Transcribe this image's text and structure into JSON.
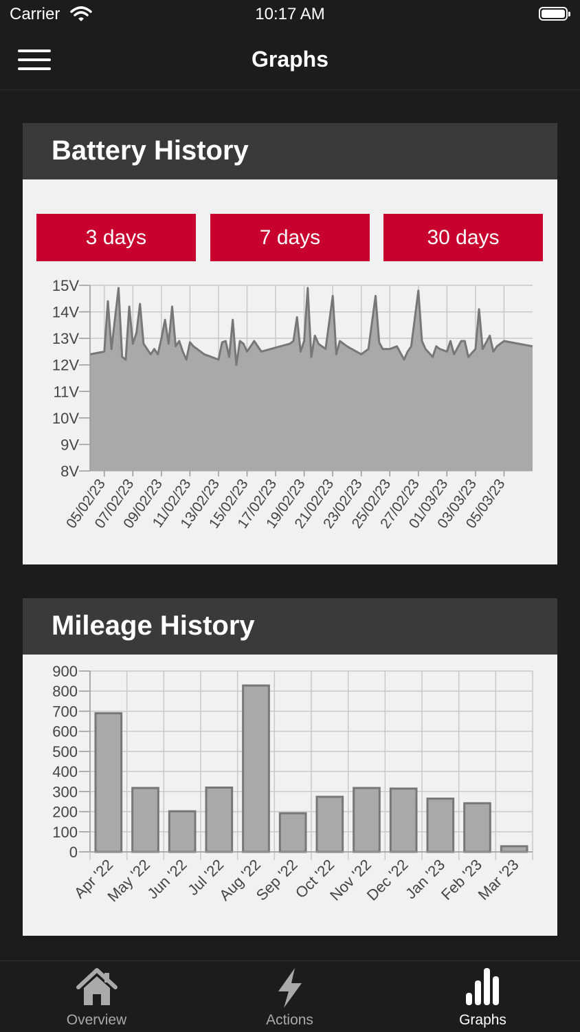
{
  "status_bar": {
    "carrier": "Carrier",
    "time": "10:17 AM"
  },
  "nav": {
    "title": "Graphs"
  },
  "battery_history": {
    "title": "Battery History",
    "range_buttons": [
      "3 days",
      "7 days",
      "30 days"
    ]
  },
  "mileage_history": {
    "title": "Mileage History"
  },
  "tabs": [
    {
      "label": "Overview",
      "icon": "house-icon",
      "active": false
    },
    {
      "label": "Actions",
      "icon": "lightning-icon",
      "active": false
    },
    {
      "label": "Graphs",
      "icon": "bar-chart-icon",
      "active": true
    }
  ],
  "colors": {
    "accent": "#c8002e",
    "chart_fill": "#a9a9a9",
    "chart_line": "#777777",
    "tab_inactive": "#aaaaaa",
    "tab_active": "#ffffff"
  },
  "chart_data": [
    {
      "type": "area",
      "x_tick_labels": [
        "05/02/23",
        "07/02/23",
        "09/02/23",
        "11/02/23",
        "13/02/23",
        "15/02/23",
        "17/02/23",
        "19/02/23",
        "21/02/23",
        "23/02/23",
        "25/02/23",
        "27/02/23",
        "01/03/23",
        "03/03/23",
        "05/03/23"
      ],
      "y_tick_labels": [
        "15V",
        "14V",
        "13V",
        "12V",
        "11V",
        "10V",
        "9V",
        "8V"
      ],
      "ylim": [
        8,
        15
      ],
      "xlim": [
        "04/02/23",
        "07/03/23"
      ],
      "grid": true,
      "series": [
        {
          "x": [
            "04/02/23",
            "04/02/23 12:00",
            "05/02/23",
            "05/02/23 06:00",
            "05/02/23 12:00",
            "06/02/23",
            "06/02/23 06:00",
            "06/02/23 12:00",
            "06/02/23 18:00",
            "07/02/23",
            "07/02/23 06:00",
            "07/02/23 12:00",
            "07/02/23 18:00",
            "08/02/23",
            "08/02/23 06:00",
            "08/02/23 12:00",
            "08/02/23 18:00",
            "09/02/23",
            "09/02/23 06:00",
            "09/02/23 12:00",
            "09/02/23 18:00",
            "10/02/23",
            "10/02/23 06:00",
            "10/02/23 12:00",
            "10/02/23 18:00",
            "11/02/23",
            "11/02/23 06:00",
            "11/02/23 12:00",
            "12/02/23",
            "13/02/23",
            "13/02/23 06:00",
            "13/02/23 12:00",
            "13/02/23 18:00",
            "14/02/23",
            "14/02/23 06:00",
            "14/02/23 12:00",
            "14/02/23 18:00",
            "15/02/23",
            "15/02/23 12:00",
            "16/02/23",
            "17/02/23",
            "18/02/23",
            "18/02/23 06:00",
            "18/02/23 12:00",
            "18/02/23 18:00",
            "19/02/23",
            "19/02/23 06:00",
            "19/02/23 12:00",
            "19/02/23 18:00",
            "20/02/23",
            "20/02/23 12:00",
            "21/02/23",
            "21/02/23 06:00",
            "21/02/23 12:00",
            "22/02/23",
            "23/02/23",
            "23/02/23 12:00",
            "24/02/23",
            "24/02/23 06:00",
            "24/02/23 12:00",
            "25/02/23",
            "25/02/23 12:00",
            "26/02/23",
            "26/02/23 06:00",
            "26/02/23 12:00",
            "27/02/23",
            "27/02/23 06:00",
            "27/02/23 12:00",
            "28/02/23",
            "28/02/23 06:00",
            "28/02/23 12:00",
            "01/03/23",
            "01/03/23 06:00",
            "01/03/23 12:00",
            "02/03/23",
            "02/03/23 06:00",
            "02/03/23 12:00",
            "03/03/23",
            "03/03/23 06:00",
            "03/03/23 12:00",
            "04/03/23",
            "04/03/23 06:00",
            "04/03/23 12:00",
            "05/03/23",
            "06/03/23",
            "07/03/23"
          ],
          "y": [
            12.4,
            12.45,
            12.5,
            14.4,
            12.6,
            14.9,
            12.3,
            12.2,
            14.2,
            12.8,
            13.2,
            14.3,
            12.8,
            12.6,
            12.4,
            12.6,
            12.4,
            13.0,
            13.7,
            12.8,
            14.2,
            12.7,
            12.9,
            12.5,
            12.2,
            12.85,
            12.7,
            12.6,
            12.4,
            12.2,
            12.85,
            12.9,
            12.3,
            13.7,
            12.0,
            12.9,
            12.8,
            12.5,
            12.9,
            12.5,
            12.65,
            12.8,
            12.9,
            13.8,
            12.5,
            12.9,
            14.9,
            12.3,
            13.1,
            12.8,
            12.6,
            14.6,
            12.4,
            12.9,
            12.7,
            12.4,
            12.6,
            14.6,
            12.85,
            12.6,
            12.6,
            12.7,
            12.2,
            12.5,
            12.7,
            14.8,
            12.9,
            12.6,
            12.3,
            12.7,
            12.6,
            12.5,
            12.9,
            12.4,
            12.9,
            12.9,
            12.3,
            12.6,
            14.1,
            12.6,
            13.1,
            12.5,
            12.7,
            12.9,
            12.8,
            12.7
          ]
        }
      ]
    },
    {
      "type": "bar",
      "categories": [
        "Apr '22",
        "May '22",
        "Jun '22",
        "Jul '22",
        "Aug '22",
        "Sep '22",
        "Oct '22",
        "Nov '22",
        "Dec '22",
        "Jan '23",
        "Feb '23",
        "Mar '23"
      ],
      "values": [
        690,
        318,
        202,
        320,
        828,
        192,
        274,
        318,
        315,
        265,
        242,
        28
      ],
      "y_tick_labels": [
        "900",
        "800",
        "700",
        "600",
        "500",
        "400",
        "300",
        "200",
        "100",
        "0"
      ],
      "ylim": [
        0,
        900
      ],
      "grid": true
    }
  ]
}
